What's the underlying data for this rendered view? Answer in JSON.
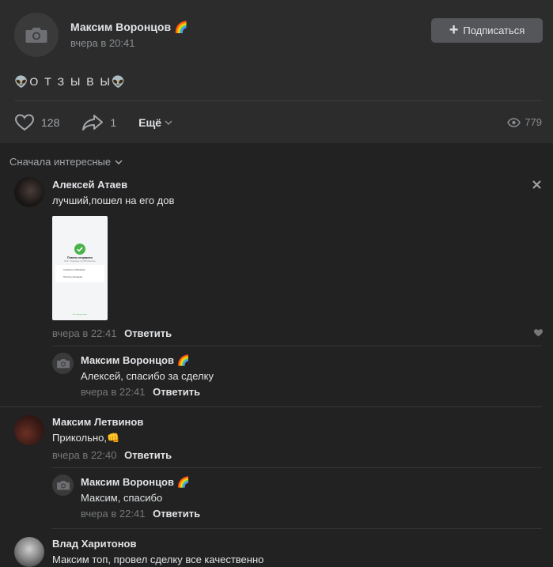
{
  "post": {
    "author": "Максим Воронцов",
    "author_emoji": "🌈",
    "date": "вчера в 20:41",
    "subscribe_label": "Подписаться",
    "text": "👽О Т З Ы В Ы👽",
    "likes": "128",
    "shares": "1",
    "more_label": "Ещё",
    "views": "779"
  },
  "comments_sort": "Сначала интересные",
  "comments": [
    {
      "author": "Алексей Атаев",
      "text": "лучший,пошел на его дов",
      "date": "вчера в 22:41",
      "reply_label": "Ответить",
      "attachment": {
        "title": "Платеж отправлен",
        "subtitle": "99 ₽ · Переводы по СБП Максиму",
        "option1": "Сохранить в Избранное",
        "option2": "Получить квитанцию",
        "footer": "На главную экран"
      },
      "reply": {
        "author": "Максим Воронцов",
        "author_emoji": "🌈",
        "text": "Алексей, спасибо за сделку",
        "date": "вчера в 22:41",
        "reply_label": "Ответить"
      }
    },
    {
      "author": "Максим Летвинов",
      "text": "Прикольно,👊",
      "date": "вчера в 22:40",
      "reply_label": "Ответить",
      "reply": {
        "author": "Максим Воронцов",
        "author_emoji": "🌈",
        "text": "Максим, спасибо",
        "date": "вчера в 22:41",
        "reply_label": "Ответить"
      }
    },
    {
      "author": "Влад Харитонов",
      "text": "Максим топ, провел сделку все качественно"
    }
  ],
  "colors": {
    "background": "#222222",
    "card": "#2c2c2c",
    "button": "#555659",
    "text": "#e1e3e6",
    "muted": "#76787a",
    "accent_green": "#4bb34b"
  }
}
